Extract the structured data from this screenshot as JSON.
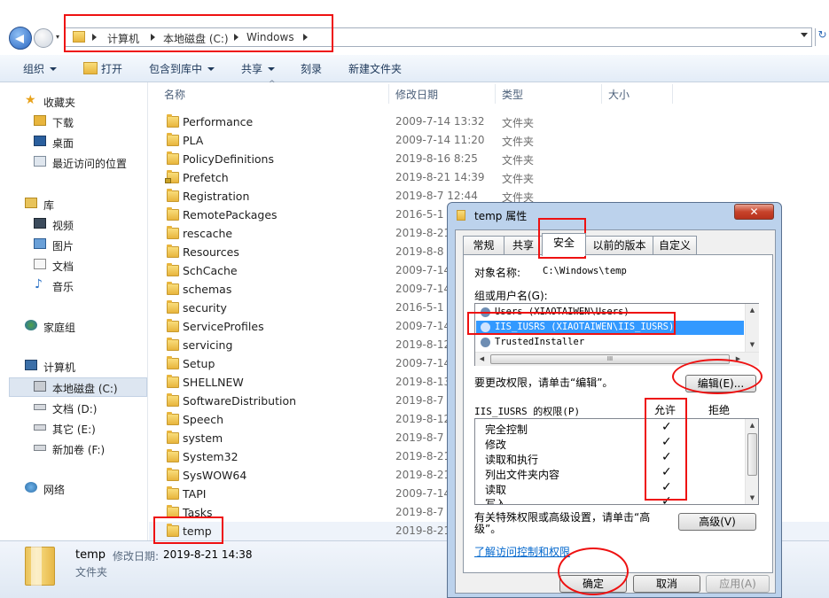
{
  "address": {
    "segments": [
      "计算机",
      "本地磁盘 (C:)",
      "Windows"
    ],
    "refresh_glyph": "↻"
  },
  "toolbar": {
    "organize": "组织",
    "open": "打开",
    "include": "包含到库中",
    "share": "共享",
    "burn": "刻录",
    "new_folder": "新建文件夹"
  },
  "nav": {
    "favorites": "收藏夹",
    "downloads": "下载",
    "desktop": "桌面",
    "recent": "最近访问的位置",
    "libraries": "库",
    "videos": "视频",
    "pictures": "图片",
    "documents": "文档",
    "music": "音乐",
    "homegroup": "家庭组",
    "computer": "计算机",
    "drive_c": "本地磁盘 (C:)",
    "drive_d": "文档 (D:)",
    "drive_e": "其它 (E:)",
    "drive_f": "新加卷 (F:)",
    "network": "网络"
  },
  "columns": {
    "name": "名称",
    "date": "修改日期",
    "type": "类型",
    "size": "大小"
  },
  "files": [
    {
      "name": "Performance",
      "date": "2009-7-14 13:32",
      "type": "文件夹"
    },
    {
      "name": "PLA",
      "date": "2009-7-14 11:20",
      "type": "文件夹"
    },
    {
      "name": "PolicyDefinitions",
      "date": "2019-8-16 8:25",
      "type": "文件夹"
    },
    {
      "name": "Prefetch",
      "date": "2019-8-21 14:39",
      "type": "文件夹"
    },
    {
      "name": "Registration",
      "date": "2019-8-7 12:44",
      "type": "文件夹"
    },
    {
      "name": "RemotePackages",
      "date": "2016-5-1",
      "type": ""
    },
    {
      "name": "rescache",
      "date": "2019-8-21",
      "type": ""
    },
    {
      "name": "Resources",
      "date": "2019-8-8",
      "type": ""
    },
    {
      "name": "SchCache",
      "date": "2009-7-14",
      "type": ""
    },
    {
      "name": "schemas",
      "date": "2009-7-14",
      "type": ""
    },
    {
      "name": "security",
      "date": "2016-5-1",
      "type": ""
    },
    {
      "name": "ServiceProfiles",
      "date": "2009-7-14",
      "type": ""
    },
    {
      "name": "servicing",
      "date": "2019-8-12",
      "type": ""
    },
    {
      "name": "Setup",
      "date": "2009-7-14",
      "type": ""
    },
    {
      "name": "SHELLNEW",
      "date": "2019-8-13",
      "type": ""
    },
    {
      "name": "SoftwareDistribution",
      "date": "2019-8-7",
      "type": ""
    },
    {
      "name": "Speech",
      "date": "2019-8-12",
      "type": ""
    },
    {
      "name": "system",
      "date": "2019-8-7",
      "type": ""
    },
    {
      "name": "System32",
      "date": "2019-8-21",
      "type": ""
    },
    {
      "name": "SysWOW64",
      "date": "2019-8-21",
      "type": ""
    },
    {
      "name": "TAPI",
      "date": "2009-7-14",
      "type": ""
    },
    {
      "name": "Tasks",
      "date": "2019-8-7",
      "type": ""
    },
    {
      "name": "temp",
      "date": "2019-8-21",
      "type": ""
    }
  ],
  "status": {
    "name": "temp",
    "date_label": "修改日期:",
    "date": "2019-8-21 14:38",
    "type": "文件夹"
  },
  "dialog": {
    "title": "temp 属性",
    "close_glyph": "✕",
    "tabs": [
      "常规",
      "共享",
      "安全",
      "以前的版本",
      "自定义"
    ],
    "object_label": "对象名称:",
    "object_value": "C:\\Windows\\temp",
    "groups_label": "组或用户名(G):",
    "users": [
      "Users (XIAOTAIWEN\\Users)",
      "IIS_IUSRS (XIAOTAIWEN\\IIS_IUSRS)",
      "TrustedInstaller"
    ],
    "hscroll_thumb": "III",
    "change_hint": "要更改权限，请单击“编辑”。",
    "edit_button": "编辑(E)...",
    "perm_title": "IIS_IUSRS 的权限(P)",
    "allow": "允许",
    "deny": "拒绝",
    "perms": [
      "完全控制",
      "修改",
      "读取和执行",
      "列出文件夹内容",
      "读取",
      "写入"
    ],
    "check": "✓",
    "special_hint": "有关特殊权限或高级设置，请单击“高级”。",
    "advanced_button": "高级(V)",
    "link": "了解访问控制和权限",
    "ok": "确定",
    "cancel": "取消",
    "apply": "应用(A)"
  }
}
